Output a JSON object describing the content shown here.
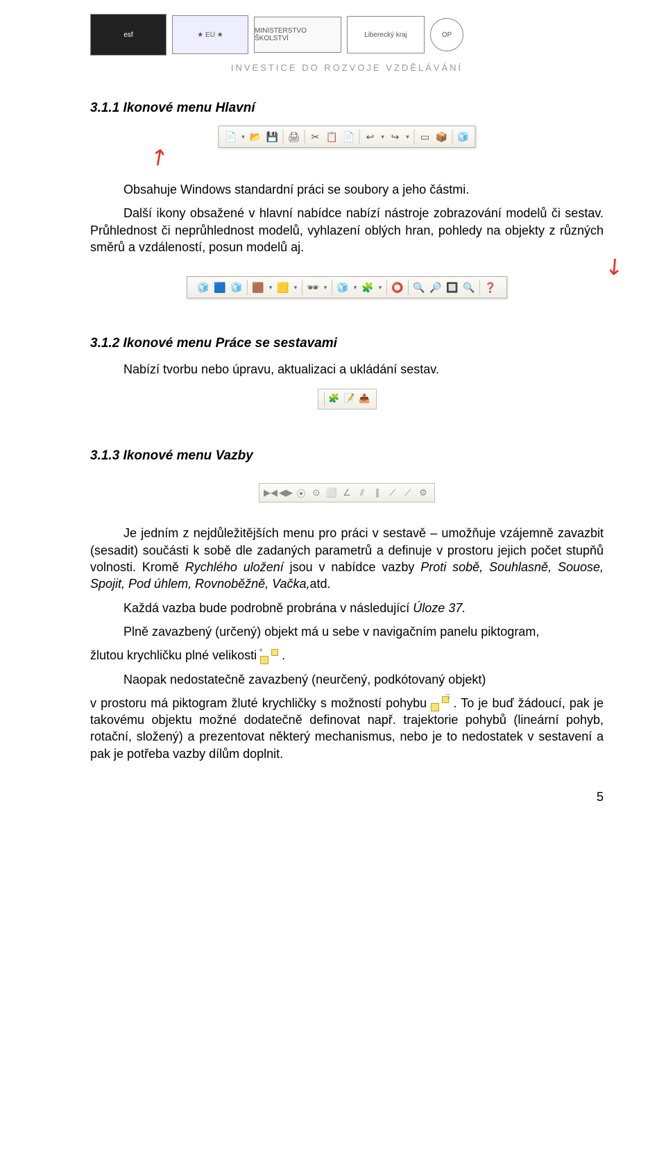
{
  "header": {
    "logos": [
      "esf",
      "eu",
      "ministerstvo",
      "liberecky-kraj",
      "op-vk"
    ],
    "subtitle": "INVESTICE DO ROZVOJE VZDĚLÁVÁNÍ"
  },
  "section1": {
    "title_num": "3.1.1 Ikonové menu ",
    "title_rest": "Hlavní",
    "p1": "Obsahuje Windows standardní práci se soubory a jeho částmi.",
    "p2": "Další ikony obsažené v hlavní nabídce nabízí nástroje zobrazování modelů či sestav. Průhlednost či neprůhlednost modelů, vyhlazení oblých hran, pohledy na objekty z různých směrů a vzdáleností, posun modelů aj."
  },
  "toolbar_main_icons": [
    "📄",
    "▾",
    "📂",
    "💾",
    "",
    "🖨",
    "",
    "✂",
    "📋",
    "📄",
    "",
    "↩",
    "▾",
    "↪",
    "▾",
    "",
    "🔲",
    "📦",
    "",
    "🧊"
  ],
  "toolbar_view_icons": [
    "🧊",
    "🟦",
    "🧊",
    "",
    "🟫",
    "▾",
    "🟨",
    "▾",
    "",
    "🕶",
    "▾",
    "",
    "🧊",
    "▾",
    "🧩",
    "▾",
    "",
    "⭕",
    "",
    "🔍",
    "🔎",
    "🔲",
    "🔍",
    "",
    "❓"
  ],
  "section2": {
    "title_num": "3.1.2 Ikonové menu ",
    "title_rest": "Práce se sestavami",
    "p1_prefix": "Nabízí tvorbu nebo úpravu, aktualizaci a ukládání sestav."
  },
  "toolbar_assembly_icons": [
    "🧩",
    "📝",
    "📤"
  ],
  "section3": {
    "title_num": "3.1.3 Ikonové menu ",
    "title_rest": "Vazby",
    "p1": "Je jedním z nejdůležitějších menu pro práci v sestavě – umožňuje vzájemně zavazbit (sesadit) součásti k sobě dle zadaných parametrů a definuje v prostoru jejich počet stupňů volnosti. Kromě ",
    "p1_italic1": "Rychlého uložení",
    "p1_mid": " jsou v nabídce vazby ",
    "p1_italic2": "Proti sobě, Souhlasně, Souose, Spojit, Pod úhlem, Rovnoběžně, Vačka,",
    "p1_end": "atd.",
    "p2_a": "Každá vazba bude podrobně probrána v následující ",
    "p2_b": "Úloze 37.",
    "p3": "Plně zavazbený (určený) objekt má u sebe v navigačním panelu piktogram,",
    "p4_before": "žlutou krychličku plné velikosti ",
    "p4_after": ".",
    "p5": "Naopak  nedostatečně  zavazbený  (neurčený,  podkótovaný  objekt)",
    "p6_before": "v prostoru má piktogram žluté krychličky s možností pohybu ",
    "p6_after": ". To je buď žádoucí, pak je takovému objektu možné dodatečně definovat např. trajektorie pohybů (lineární pohyb, rotační, složený) a  prezentovat některý mechanismus, nebo je to nedostatek v sestavení a pak je potřeba vazby dílům doplnit."
  },
  "toolbar_constraints_icons": [
    "▶◀",
    "◀▶",
    "⦿",
    "⊙",
    "⬜",
    "∠",
    "⫽",
    "∥",
    "⟋",
    "⟋",
    "⚙"
  ],
  "page_number": "5"
}
